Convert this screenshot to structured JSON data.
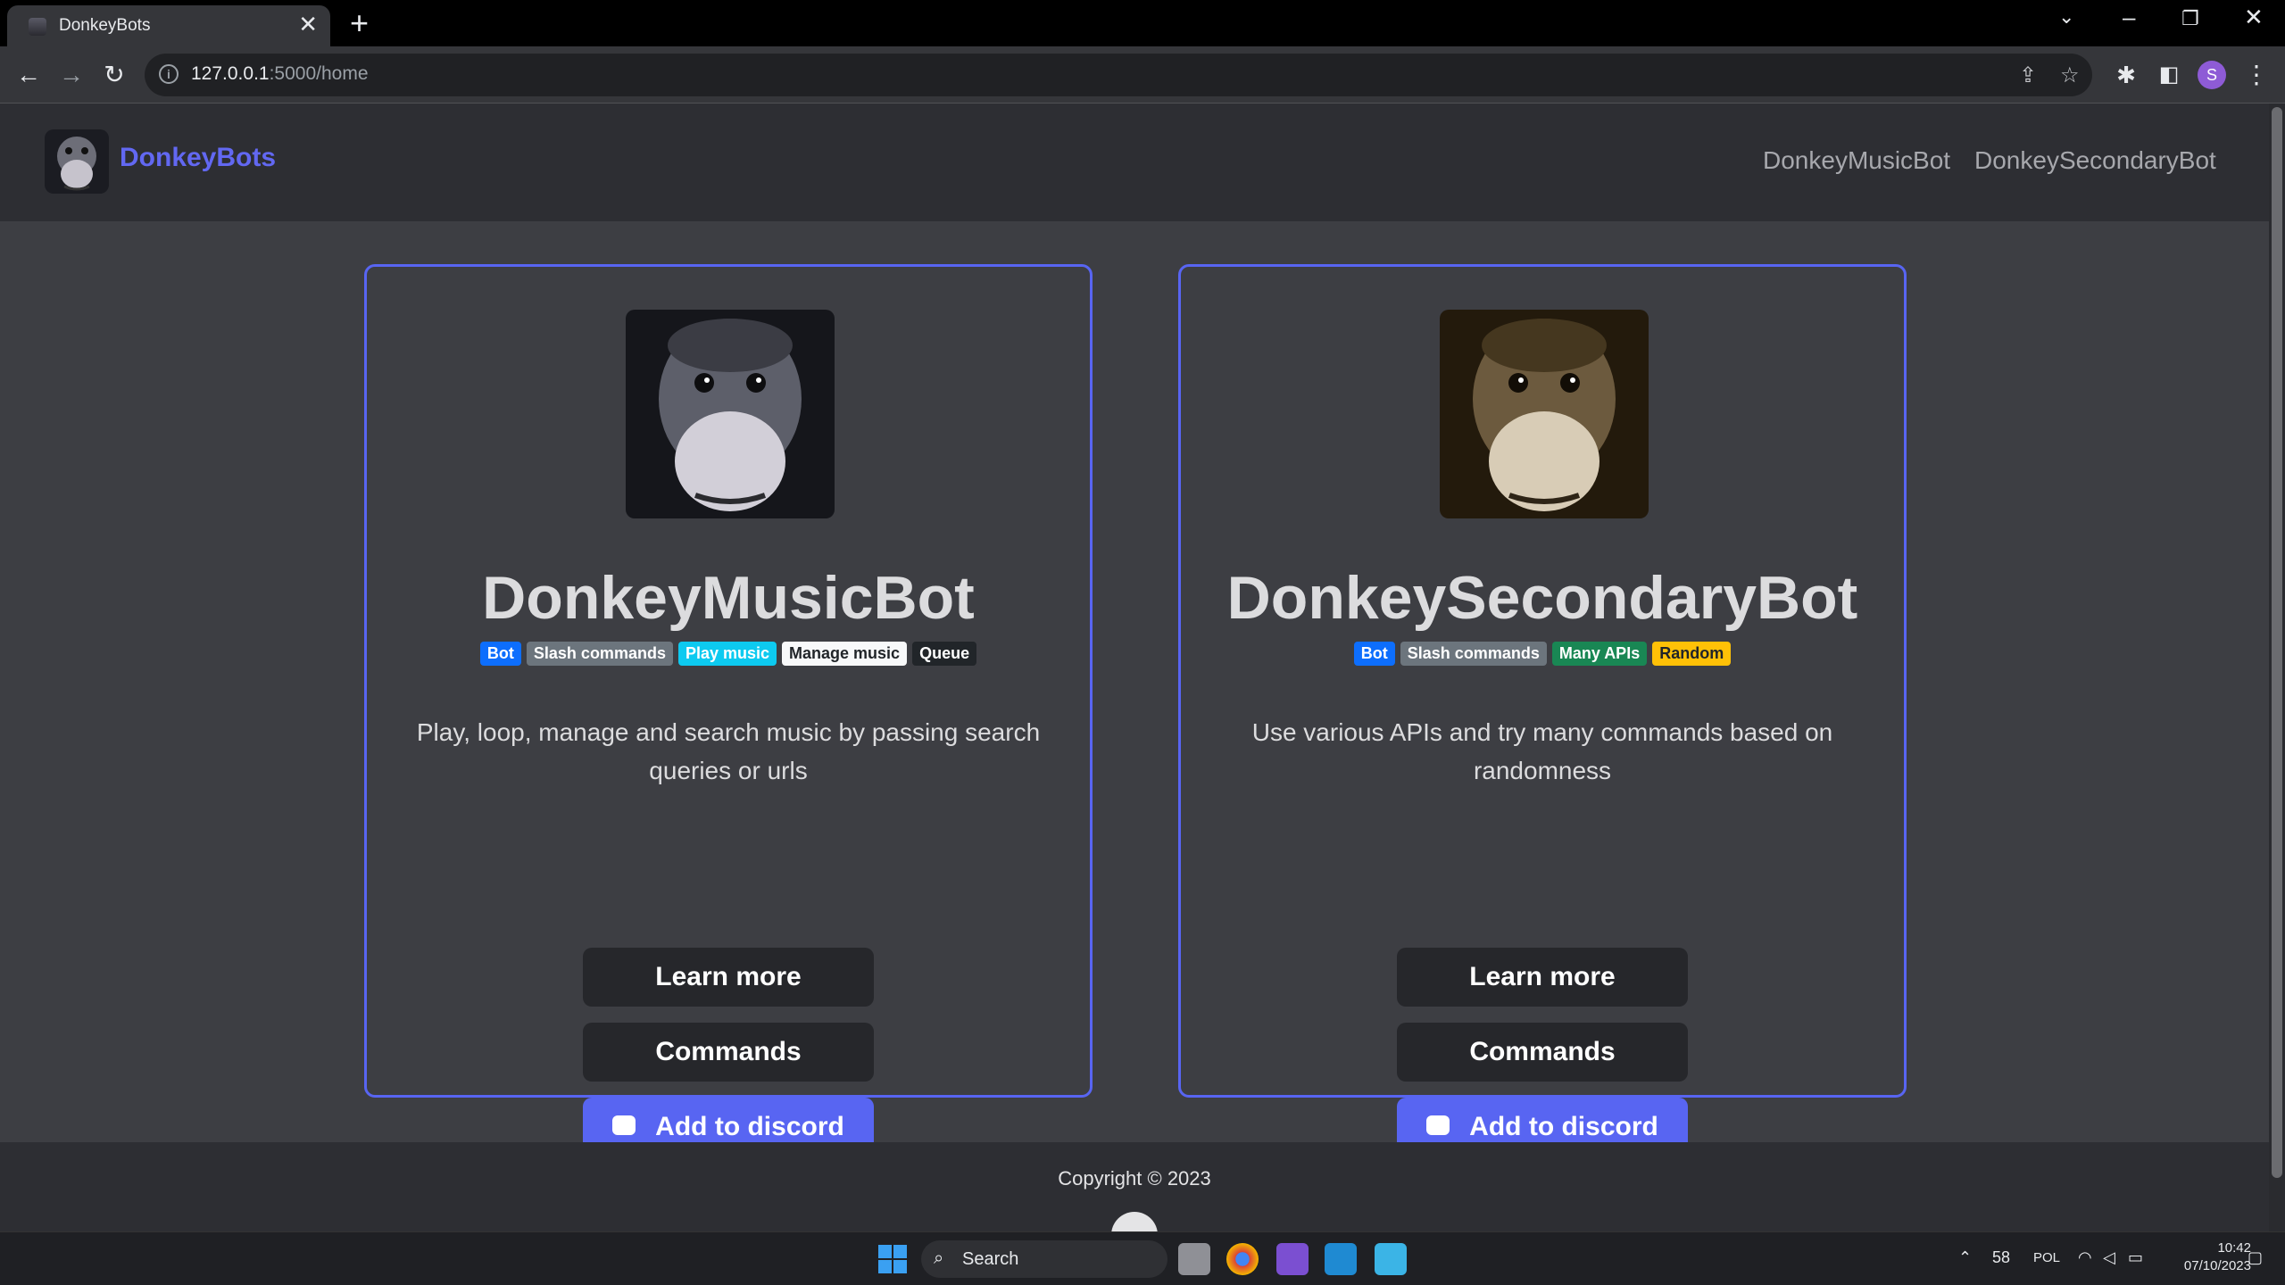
{
  "browser": {
    "tab_title": "DonkeyBots",
    "tab_close": "✕",
    "new_tab": "+",
    "url_host": "127.0.0.1",
    "url_path": ":5000/home",
    "avatar_letter": "S"
  },
  "navbar": {
    "brand": "DonkeyBots",
    "links": [
      "DonkeyMusicBot",
      "DonkeySecondaryBot"
    ]
  },
  "cards": [
    {
      "title": "DonkeyMusicBot",
      "badges": [
        {
          "label": "Bot",
          "color": "#0d6efd"
        },
        {
          "label": "Slash commands",
          "color": "#6c757d"
        },
        {
          "label": "Play music",
          "color": "#0dcaf0"
        },
        {
          "label": "Manage music",
          "color": "#f8f9fa"
        },
        {
          "label": "Queue",
          "color": "#212529"
        }
      ],
      "description": "Play, loop, manage and search music by passing search queries or urls",
      "buttons": {
        "learn": "Learn more",
        "commands": "Commands",
        "discord": "Add to discord"
      }
    },
    {
      "title": "DonkeySecondaryBot",
      "badges": [
        {
          "label": "Bot",
          "color": "#0d6efd"
        },
        {
          "label": "Slash commands",
          "color": "#6c757d"
        },
        {
          "label": "Many APIs",
          "color": "#198754"
        },
        {
          "label": "Random",
          "color": "#ffc107"
        }
      ],
      "description": "Use various APIs and try many commands based on randomness",
      "buttons": {
        "learn": "Learn more",
        "commands": "Commands",
        "discord": "Add to discord"
      }
    }
  ],
  "footer": {
    "copyright": "Copyright © 2023"
  },
  "taskbar": {
    "search_label": "Search",
    "tray_temp": "58",
    "tray_lang": "POL",
    "time": "10:42",
    "date": "07/10/2023"
  },
  "colors": {
    "accent": "#5865f2",
    "brand": "#6268f2",
    "page_bg": "#3d3e43",
    "nav_bg": "#2d2e33"
  }
}
